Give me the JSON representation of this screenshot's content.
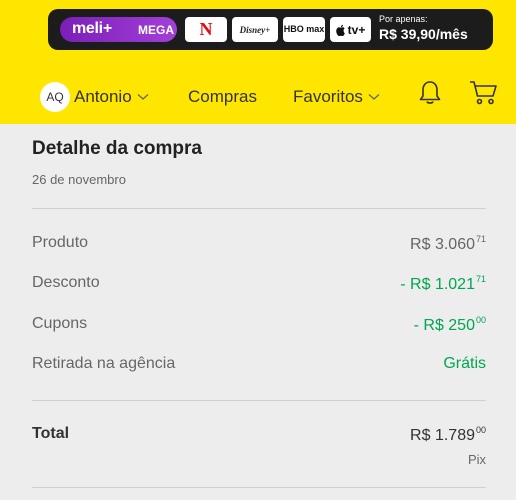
{
  "promo": {
    "brand": "meli+",
    "tier": "MEGA",
    "services": [
      "N",
      "Disney+",
      "HBO max",
      "tv+"
    ],
    "price_caption": "Por apenas:",
    "price": "R$ 39,90/mês"
  },
  "header": {
    "avatar_initials": "AQ",
    "account_name": "Antonio",
    "nav": [
      "Compras",
      "Favoritos"
    ],
    "icons": [
      "bell-icon",
      "cart-icon"
    ]
  },
  "purchase": {
    "title": "Detalhe da compra",
    "date": "26 de novembro",
    "lines": [
      {
        "label": "Produto",
        "int": "R$ 3.060",
        "cents": "71"
      },
      {
        "label": "Desconto",
        "int": "- R$ 1.021",
        "cents": "71"
      },
      {
        "label": "Cupons",
        "int": "- R$ 250",
        "cents": "00"
      },
      {
        "label": "Retirada na agência",
        "text": "Grátis"
      }
    ],
    "total": {
      "label": "Total",
      "int": "R$ 1.789",
      "cents": "00",
      "method": "Pix"
    }
  },
  "colors": {
    "header_bg": "#ffe600",
    "promo_bg": "#1c1c1c",
    "meli_purple": "#8a2be2",
    "green": "#00a650",
    "netflix_red": "#e50914"
  }
}
